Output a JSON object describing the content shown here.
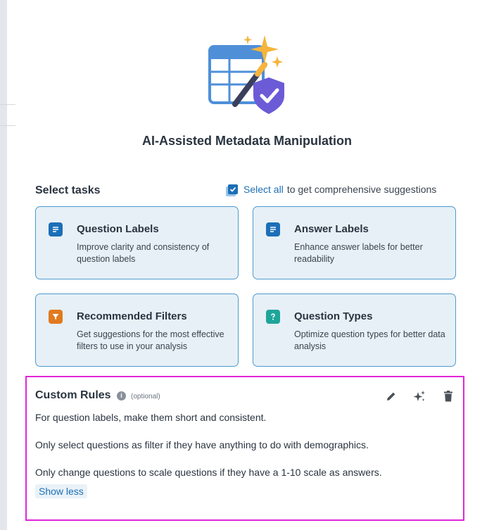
{
  "header": {
    "title": "AI-Assisted Metadata Manipulation"
  },
  "tasks": {
    "section_label": "Select tasks",
    "select_all": {
      "checked": true,
      "link_label": "Select all",
      "suffix": "to get comprehensive suggestions"
    },
    "cards": [
      {
        "title": "Question Labels",
        "description": "Improve clarity and consistency of question labels",
        "icon": "document-lines-icon",
        "icon_color": "#1c6fb7"
      },
      {
        "title": "Answer Labels",
        "description": "Enhance answer labels for better readability",
        "icon": "document-lines-icon",
        "icon_color": "#1c6fb7"
      },
      {
        "title": "Recommended Filters",
        "description": "Get suggestions for the most effective filters to use in your analysis",
        "icon": "filter-icon",
        "icon_color": "#e27a1e"
      },
      {
        "title": "Question Types",
        "description": "Optimize question types for better data analysis",
        "icon": "question-mark-icon",
        "icon_color": "#1ea59a"
      }
    ]
  },
  "custom_rules": {
    "title": "Custom Rules",
    "info_glyph": "i",
    "optional_label": "(optional)",
    "rules": [
      "For question labels, make them short and consistent.",
      "Only select questions as filter if they have anything to do with demographics.",
      "Only change questions to scale questions if they have a 1-10 scale as answers."
    ],
    "toggle_label": "Show less",
    "actions": [
      "pencil-icon",
      "sparkle-icon",
      "trash-icon"
    ],
    "highlight_color": "#e225d9"
  },
  "colors": {
    "accent": "#1c6fb7",
    "card_background": "#e7f0f6",
    "card_border": "#4c9bd0"
  }
}
